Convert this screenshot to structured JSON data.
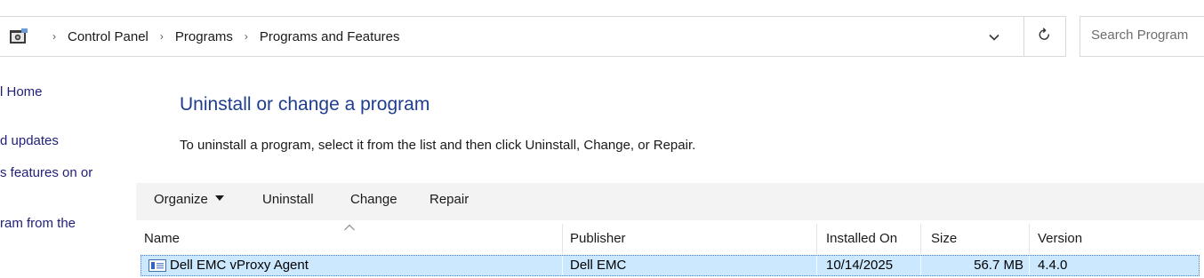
{
  "address_bar": {
    "icon": "control-panel-icon",
    "breadcrumbs": [
      "Control Panel",
      "Programs",
      "Programs and Features"
    ],
    "dropdown_icon": "chevron-down-icon",
    "refresh_icon": "refresh-icon"
  },
  "search": {
    "placeholder": "Search Program"
  },
  "left_pane": {
    "links": [
      "l Home",
      "d updates",
      "s features on or",
      "ram from the"
    ]
  },
  "main": {
    "title": "Uninstall or change a program",
    "description": "To uninstall a program, select it from the list and then click Uninstall, Change, or Repair."
  },
  "toolbar": {
    "organize_label": "Organize",
    "uninstall_label": "Uninstall",
    "change_label": "Change",
    "repair_label": "Repair"
  },
  "table": {
    "columns": [
      "Name",
      "Publisher",
      "Installed On",
      "Size",
      "Version"
    ],
    "sort_icon": "sort-up-icon",
    "rows": [
      {
        "name": "Dell EMC vProxy Agent",
        "publisher": "Dell EMC",
        "installed_on": "10/14/2025",
        "size": "56.7 MB",
        "version": "4.4.0",
        "icon": "program-icon",
        "selected": true
      }
    ]
  },
  "colors": {
    "title_blue": "#1e3d8f",
    "link_blue": "#1f1f7a",
    "selection_bg": "#cce8ff",
    "selection_border": "#3d7fd1",
    "toolbar_bg": "#f3f3f3"
  }
}
